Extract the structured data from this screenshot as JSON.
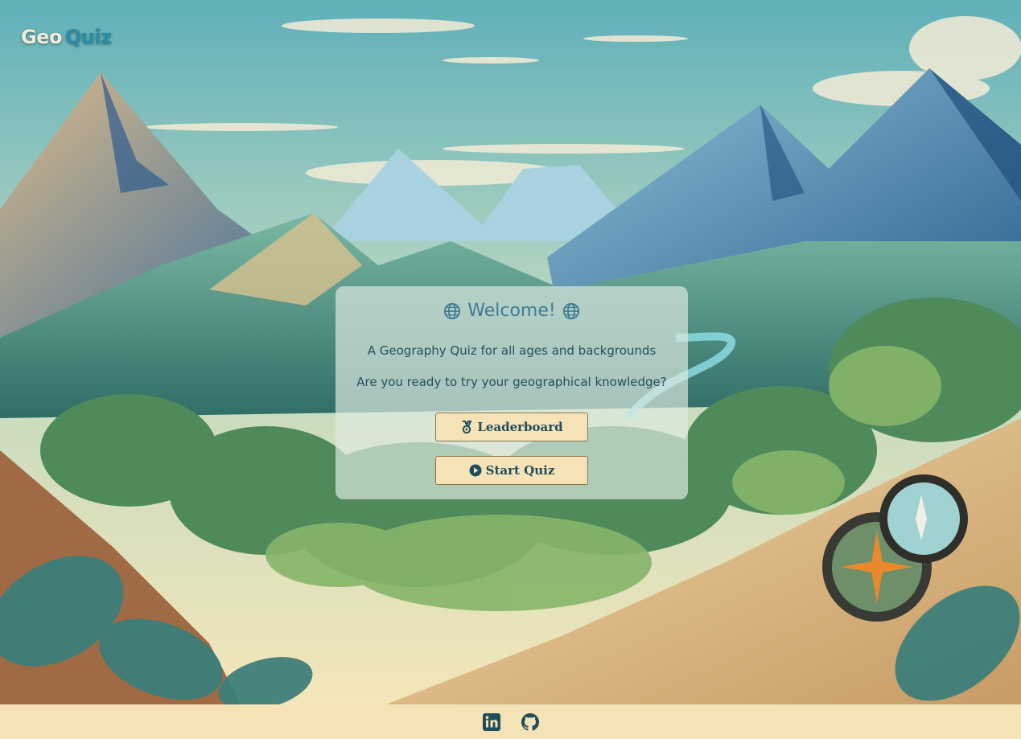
{
  "header": {
    "logo_part1": "Geo",
    "logo_part2": "Quiz"
  },
  "welcome": {
    "title": "Welcome!",
    "subtitle": "A Geography Quiz for all ages and backgrounds",
    "question": "Are you ready to try your geographical knowledge?"
  },
  "buttons": {
    "leaderboard_label": "Leaderboard",
    "leaderboard_icon": "medal-icon",
    "start_label": "Start Quiz",
    "start_icon": "play-circle-icon"
  },
  "footer": {
    "links": [
      {
        "icon": "linkedin-icon"
      },
      {
        "icon": "github-icon"
      }
    ]
  },
  "colors": {
    "accent": "#2c8ca6",
    "button_bg": "#f6e2b7",
    "button_text": "#1f4d5c",
    "footer_bg": "#f6e2b7"
  }
}
